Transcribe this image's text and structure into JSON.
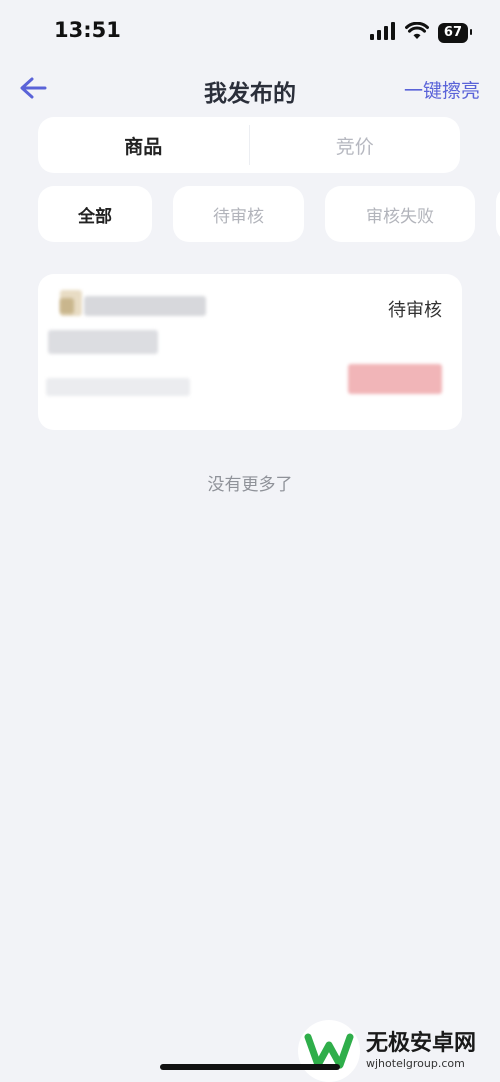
{
  "status_bar": {
    "time": "13:51",
    "battery": "67"
  },
  "nav": {
    "title": "我发布的",
    "action_label": "一键擦亮"
  },
  "segments": [
    {
      "label": "商品",
      "active": true
    },
    {
      "label": "竞价",
      "active": false
    }
  ],
  "filters": [
    {
      "label": "全部",
      "active": true
    },
    {
      "label": "待审核",
      "active": false
    },
    {
      "label": "审核失败",
      "active": false
    }
  ],
  "card": {
    "status": "待审核"
  },
  "footer": {
    "text": "没有更多了"
  },
  "watermark": {
    "title": "无极安卓网",
    "url": "wjhotelgroup.com"
  },
  "colors": {
    "accent": "#5a63d8",
    "background": "#f2f3f7",
    "price_blur": "#f1b5b8"
  }
}
